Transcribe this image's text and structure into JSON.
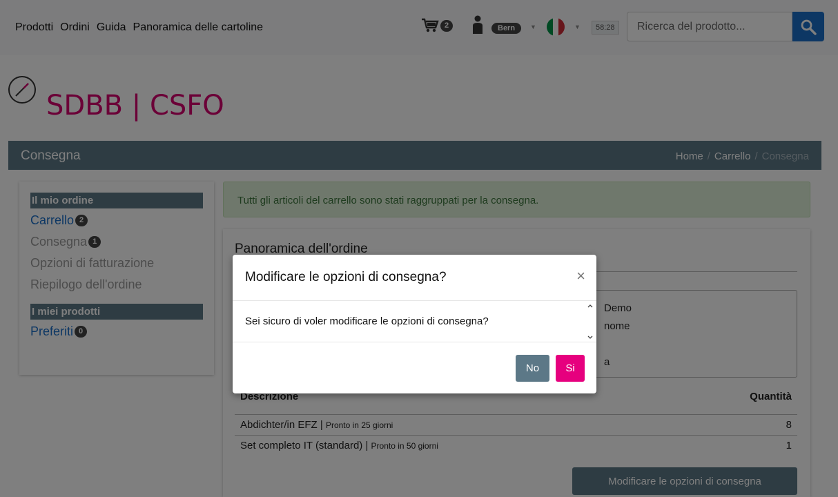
{
  "nav": {
    "links": [
      "Prodotti",
      "Ordini",
      "Guida",
      "Panoramica delle cartoline"
    ],
    "cart_count": "2",
    "user_label": "Bern",
    "timer": "58:28",
    "search_placeholder": "Ricerca del prodotto...",
    "icons": [
      "cart-icon",
      "user-icon",
      "italy-flag-icon",
      "search-icon"
    ]
  },
  "logo": {
    "text": "SDBB | CSFO"
  },
  "page": {
    "title": "Consegna",
    "breadcrumb": [
      "Home",
      "Carrello",
      "Consegna"
    ]
  },
  "sidebar": {
    "order_heading": "Il mio ordine",
    "order_items": [
      {
        "label": "Carrello",
        "badge": "2"
      },
      {
        "label": "Consegna",
        "badge": "1"
      },
      {
        "label": "Opzioni di fatturazione"
      },
      {
        "label": "Riepilogo dell'ordine"
      }
    ],
    "products_heading": "I miei prodotti",
    "product_items": [
      {
        "label": "Preferiti",
        "badge": "0"
      }
    ]
  },
  "alert": {
    "text": "Tutti gli articoli del carrello sono stati raggruppati per la consegna."
  },
  "overview": {
    "title": "Panoramica dell'ordine",
    "address_fragments": [
      "Demo",
      "nome",
      "a"
    ],
    "columns": {
      "description": "Descrizione",
      "quantity": "Quantità"
    },
    "rows": [
      {
        "name": "Abdichter/in EFZ |",
        "note": "Pronto in 25 giorni",
        "qty": "8"
      },
      {
        "name": "Set completo IT (standard) |",
        "note": "Pronto in 50 giorni",
        "qty": "1"
      }
    ],
    "modify_button": "Modificare le opzioni di consegna"
  },
  "modal": {
    "title": "Modificare le opzioni di consegna?",
    "body": "Sei sicuro di voler modificare le opzioni di consegna?",
    "no_label": "No",
    "yes_label": "Si"
  },
  "colors": {
    "brand": "#d6006f",
    "slate": "#5c7887",
    "primary": "#1a6fc9",
    "yes": "#e6007e"
  }
}
